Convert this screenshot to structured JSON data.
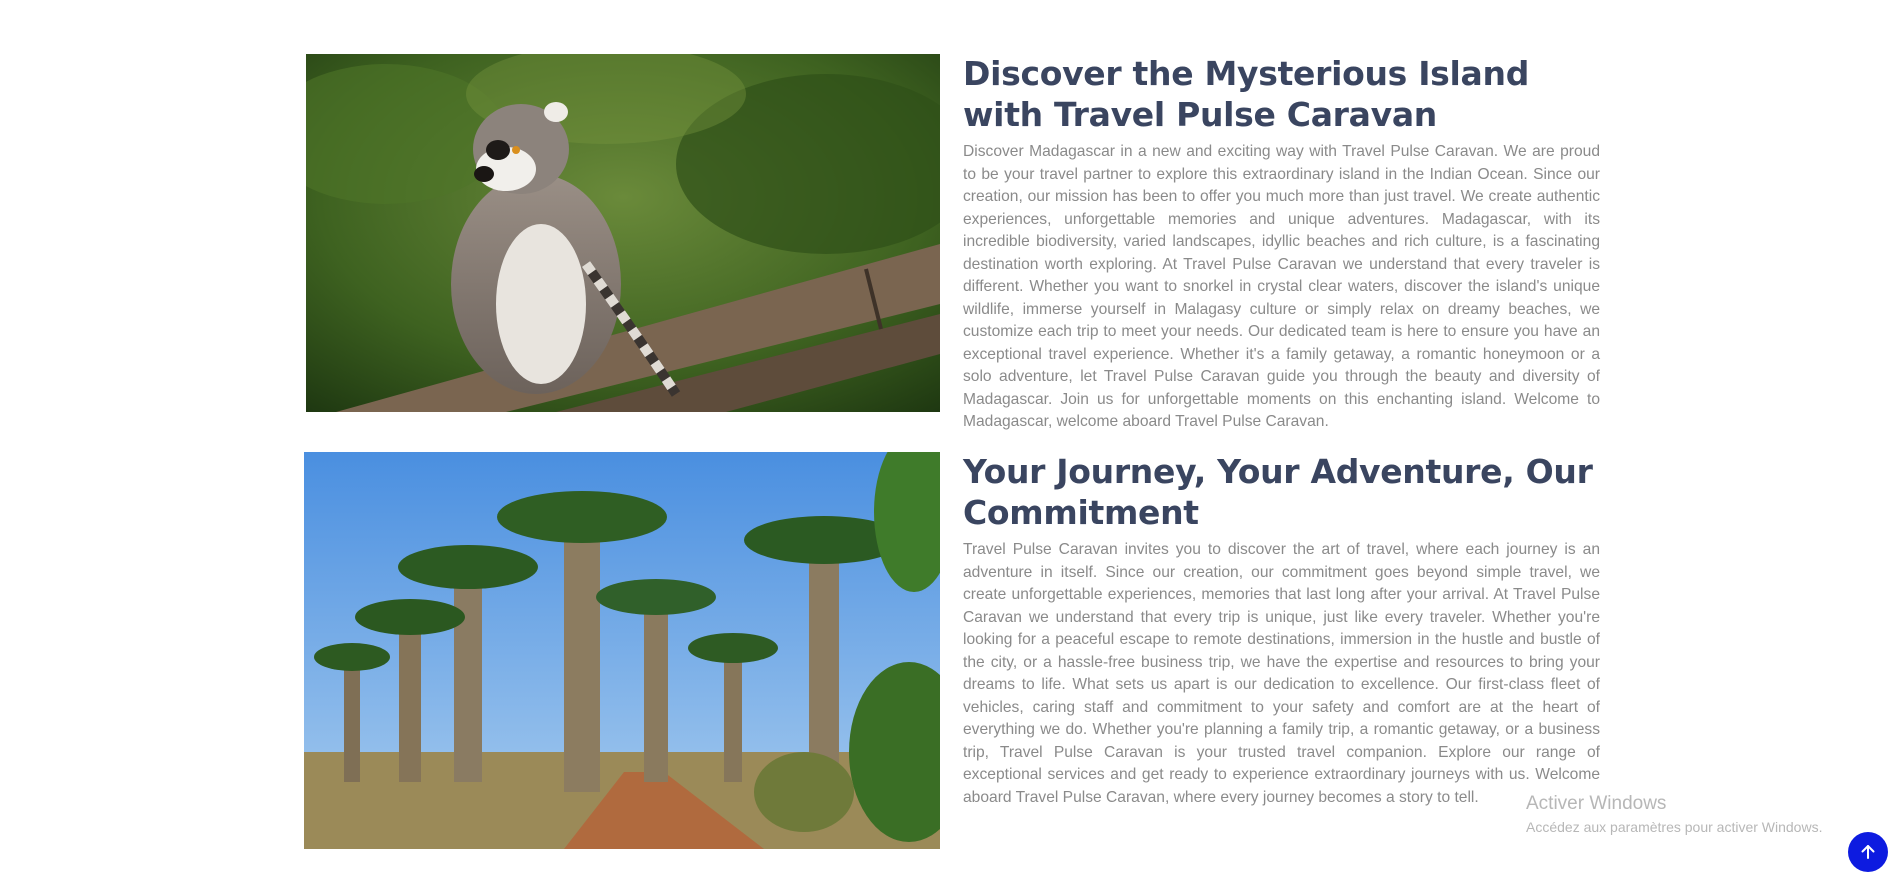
{
  "sections": [
    {
      "heading": "Discover the Mysterious Island with Travel Pulse Caravan",
      "body": "Discover Madagascar in a new and exciting way with Travel Pulse Caravan. We are proud to be your travel partner to explore this extraordinary island in the Indian Ocean. Since our creation, our mission has been to offer you much more than just travel. We create authentic experiences, unforgettable memories and unique adventures. Madagascar, with its incredible biodiversity, varied landscapes, idyllic beaches and rich culture, is a fascinating destination worth exploring. At Travel Pulse Caravan we understand that every traveler is different. Whether you want to snorkel in crystal clear waters, discover the island's unique wildlife, immerse yourself in Malagasy culture or simply relax on dreamy beaches, we customize each trip to meet your needs. Our dedicated team is here to ensure you have an exceptional travel experience. Whether it's a family getaway, a romantic honeymoon or a solo adventure, let Travel Pulse Caravan guide you through the beauty and diversity of Madagascar. Join us for unforgettable moments on this enchanting island. Welcome to Madagascar, welcome aboard Travel Pulse Caravan."
    },
    {
      "heading": "Your Journey, Your Adventure, Our Commitment",
      "body": "Travel Pulse Caravan invites you to discover the art of travel, where each journey is an adventure in itself. Since our creation, our commitment goes beyond simple travel, we create unforgettable experiences, memories that last long after your arrival. At Travel Pulse Caravan we understand that every trip is unique, just like every traveler. Whether you're looking for a peaceful escape to remote destinations, immersion in the hustle and bustle of the city, or a hassle-free business trip, we have the expertise and resources to bring your dreams to life. What sets us apart is our dedication to excellence. Our first-class fleet of vehicles, caring staff and commitment to your safety and comfort are at the heart of everything we do. Whether you're planning a family trip, a romantic getaway, or a business trip, Travel Pulse Caravan is your trusted travel companion. Explore our range of exceptional services and get ready to experience extraordinary journeys with us. Welcome aboard Travel Pulse Caravan, where every journey becomes a story to tell."
    }
  ],
  "watermark": {
    "title": "Activer Windows",
    "subtitle": "Accédez aux paramètres pour activer Windows."
  },
  "scroll_top": {
    "icon": "arrow-up-icon",
    "color": "#0d1be0"
  },
  "colors": {
    "heading": "#3a4560",
    "body": "#8a8a8a"
  }
}
